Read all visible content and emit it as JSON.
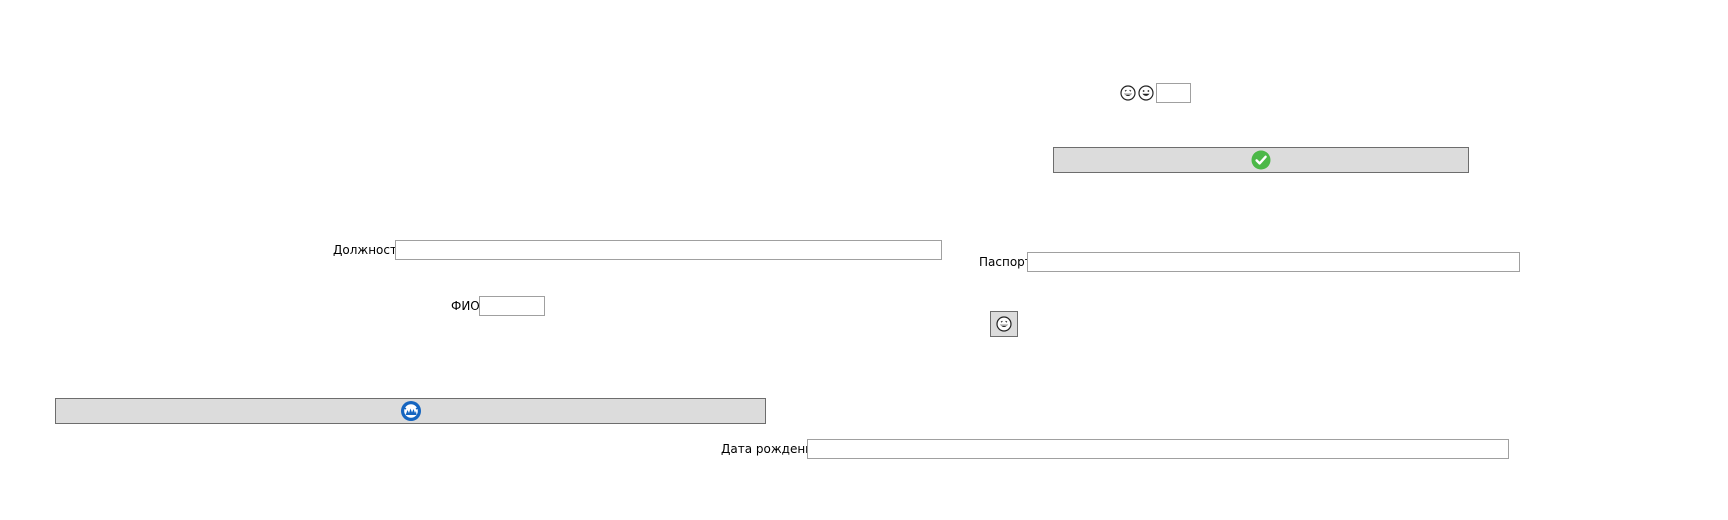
{
  "form": {
    "position_label": "Должность",
    "position_value": "",
    "name_label": "ФИО",
    "name_value": "",
    "passport_label": "Паспорт",
    "passport_value": "",
    "birthdate_label": "Дата рождения",
    "birthdate_value": "",
    "small_value": ""
  },
  "icons": {
    "grin": "grinning-face-icon",
    "smile": "smiling-face-icon",
    "check": "green-checkmark-icon",
    "refresh": "blue-circle-icon",
    "button_emoji": "grinning-face-icon"
  },
  "colors": {
    "button_bg": "#dcdcdc",
    "button_border": "#6d6d6d",
    "input_border": "#a0a0a0",
    "check_green": "#4cb848",
    "refresh_blue": "#1565c0"
  }
}
